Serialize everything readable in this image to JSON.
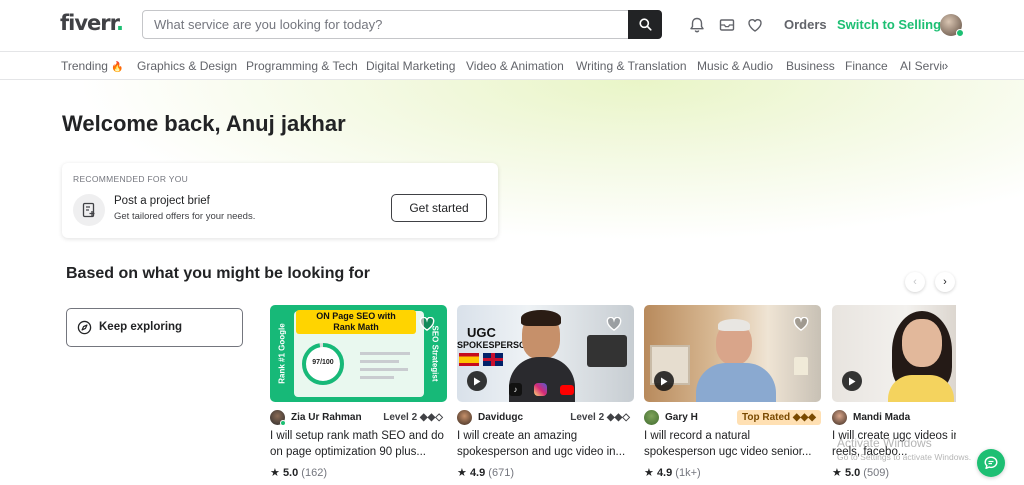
{
  "header": {
    "logo": "fiverr",
    "logo_dot": ".",
    "search_placeholder": "What service are you looking for today?",
    "orders": "Orders",
    "switch_selling": "Switch to Selling"
  },
  "categories": {
    "trending": "Trending",
    "trending_emoji": "🔥",
    "items": [
      "Graphics & Design",
      "Programming & Tech",
      "Digital Marketing",
      "Video & Animation",
      "Writing & Translation",
      "Music & Audio",
      "Business",
      "Finance",
      "AI Servic"
    ]
  },
  "welcome": "Welcome back, Anuj jakhar",
  "recommended": {
    "label": "RECOMMENDED FOR YOU",
    "title": "Post a project brief",
    "subtitle": "Get tailored offers for your needs.",
    "button": "Get started"
  },
  "section_title": "Based on what you might be looking for",
  "explore_label": "Keep exploring",
  "gigs": [
    {
      "seller": "Zia Ur Rahman",
      "level": "Level 2 ◆◆◇",
      "title": "I will setup rank math SEO and do on page optimization 90 plus...",
      "rating": "5.0",
      "count": "(162)",
      "thumb_texts": [
        "ON Page SEO with",
        "Rank Math",
        "Rank #1 Google",
        "SEO Strategist",
        "97/100"
      ]
    },
    {
      "seller": "Davidugc",
      "level": "Level 2 ◆◆◇",
      "title": "I will create an amazing spokesperson and ugc video in...",
      "rating": "4.9",
      "count": "(671)",
      "thumb_texts": [
        "UGC",
        "SPOKESPERSON"
      ]
    },
    {
      "seller": "Gary H",
      "level": "Top Rated ◆◆◆",
      "title": "I will record a natural spokesperson ugc video senior...",
      "rating": "4.9",
      "count": "(1k+)"
    },
    {
      "seller": "Mandi Mada",
      "level": "",
      "title": "I will create ugc videos instagram reels, facebo...",
      "rating": "5.0",
      "count": "(509)"
    }
  ],
  "watermark": {
    "line1": "Activate Windows",
    "line2": "Go to Settings to activate Windows."
  },
  "colors": {
    "brand_green": "#1dbf73",
    "dark": "#222325",
    "top_rated_bg": "#ffe0b3"
  },
  "icons": [
    "search-icon",
    "bell-icon",
    "mail-icon",
    "heart-icon",
    "fire-icon",
    "brief-icon",
    "compass-icon",
    "chevron-left-icon",
    "chevron-right-icon",
    "play-icon",
    "star-icon",
    "chat-icon"
  ]
}
